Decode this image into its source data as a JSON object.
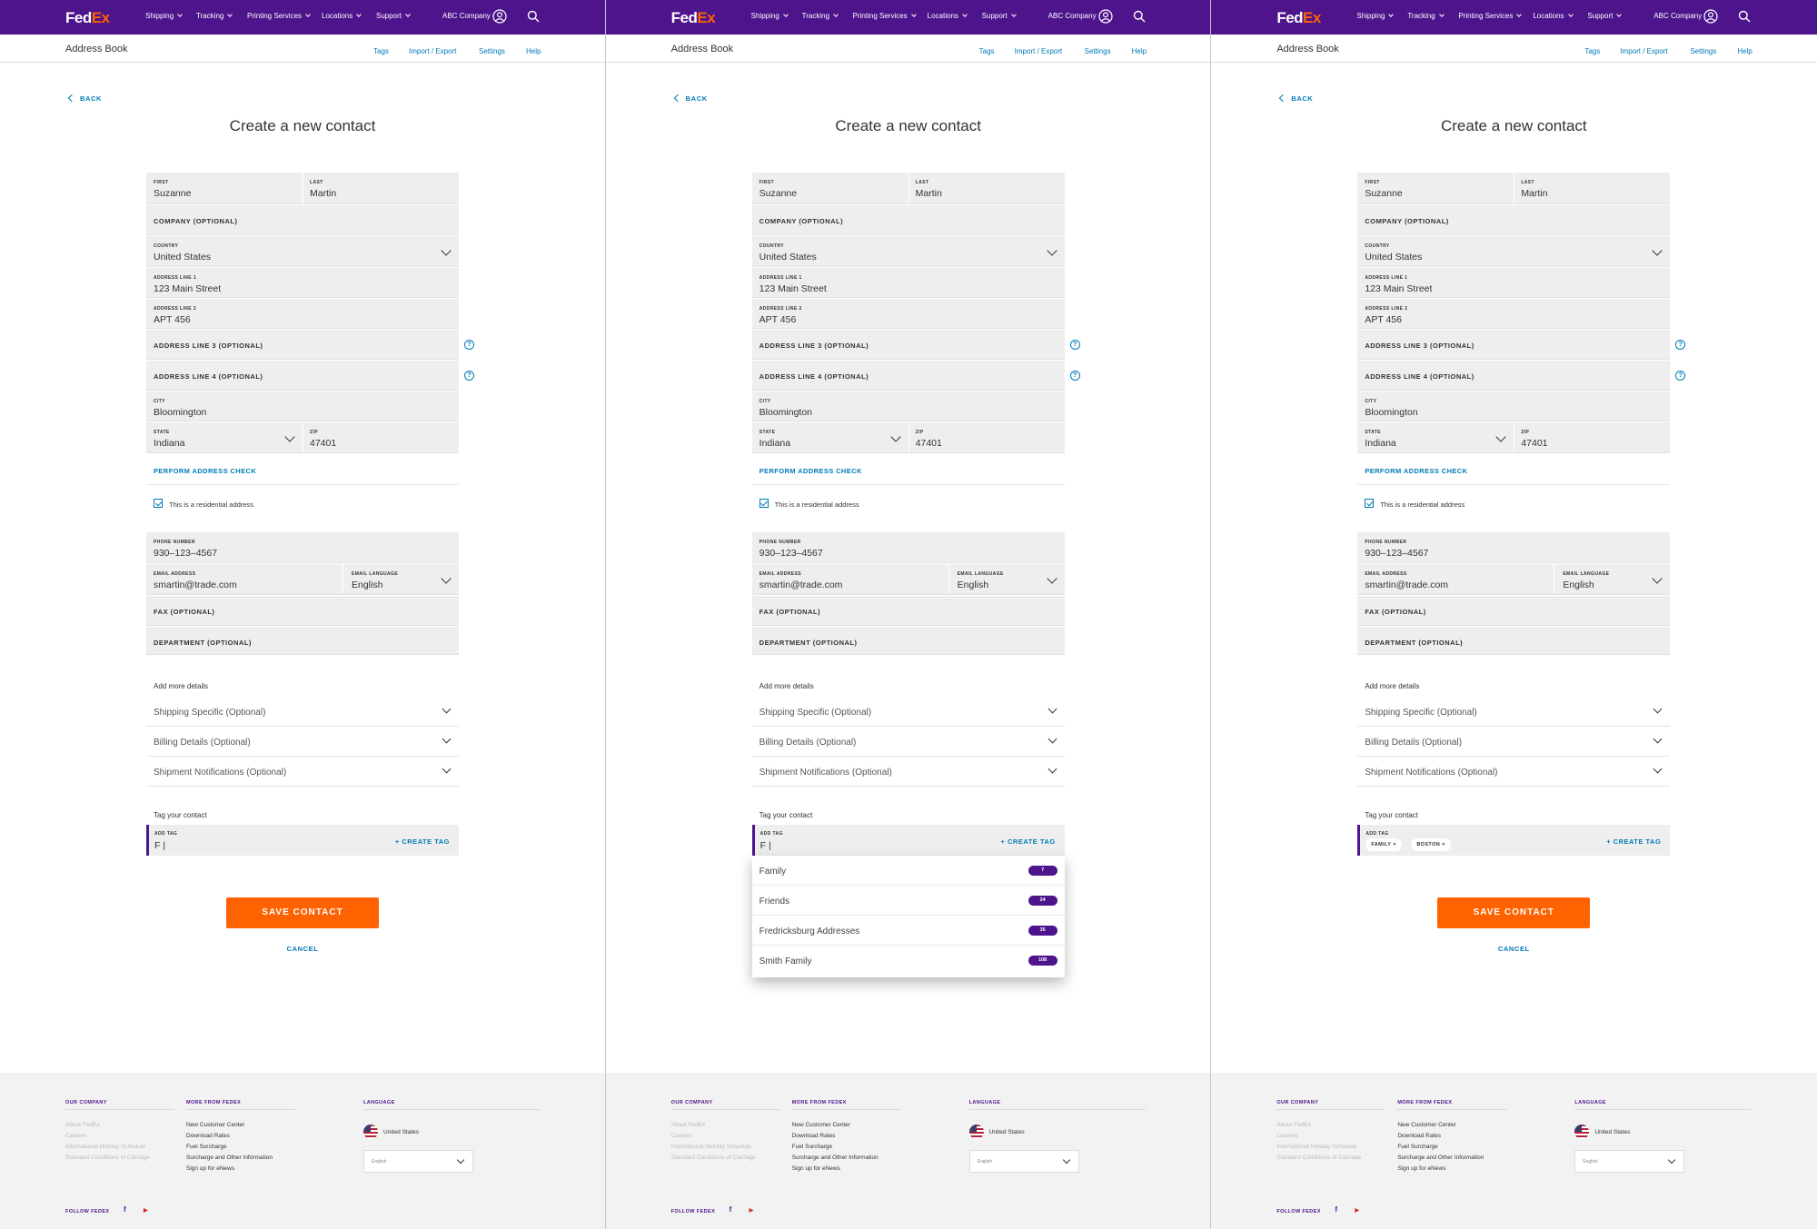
{
  "colors": {
    "brand_purple": "#4d148c",
    "brand_orange": "#ff6200",
    "link_blue": "#007ab7"
  },
  "nav": {
    "logo_fed": "Fed",
    "logo_ex": "Ex",
    "items": [
      "Shipping",
      "Tracking",
      "Printing Services",
      "Locations",
      "Support"
    ],
    "account": "ABC Company",
    "account_icon": "user-circle-icon",
    "search_icon": "search-icon"
  },
  "subnav": {
    "title": "Address Book",
    "links": [
      "Tags",
      "Import / Export",
      "Settings",
      "Help"
    ]
  },
  "back": "BACK",
  "page_title": "Create a new contact",
  "form": {
    "first_label": "FIRST",
    "first_value": "Suzanne",
    "last_label": "LAST",
    "last_value": "Martin",
    "company": "COMPANY (OPTIONAL)",
    "country_label": "COUNTRY",
    "country_value": "United States",
    "addr1_label": "ADDRESS LINE 1",
    "addr1_value": "123 Main Street",
    "addr2_label": "ADDRESS LINE 2",
    "addr2_value": "APT 456",
    "addr3": "ADDRESS LINE 3 (OPTIONAL)",
    "addr4": "ADDRESS LINE 4 (OPTIONAL)",
    "city_label": "CITY",
    "city_value": "Bloomington",
    "state_label": "STATE",
    "state_value": "Indiana",
    "zip_label": "ZIP",
    "zip_value": "47401",
    "address_check": "PERFORM ADDRESS CHECK",
    "residential": "This is a residential address",
    "phone_label": "PHONE NUMBER",
    "phone_value": "930–123–4567",
    "email_label": "EMAIL ADDRESS",
    "email_value": "smartin@trade.com",
    "email_lang_label": "EMAIL LANGUAGE",
    "email_lang_value": "English",
    "fax": "FAX (OPTIONAL)",
    "department": "DEPARTMENT (OPTIONAL)",
    "help_glyph": "?"
  },
  "more_details": {
    "title": "Add more details",
    "sections": [
      "Shipping Specific (Optional)",
      "Billing Details (Optional)",
      "Shipment Notifications (Optional)"
    ]
  },
  "tags": {
    "title": "Tag your contact",
    "add_label": "ADD TAG",
    "input_value": "F |",
    "create": "+ CREATE TAG",
    "suggestions": [
      {
        "name": "Family",
        "count": "7"
      },
      {
        "name": "Friends",
        "count": "24"
      },
      {
        "name": "Fredricksburg Addresses",
        "count": "35"
      },
      {
        "name": "Smith Family",
        "count": "108"
      }
    ],
    "chips": [
      "FAMILY ×",
      "BOSTON ×"
    ]
  },
  "save": "SAVE CONTACT",
  "cancel": "CANCEL",
  "footer": {
    "our_company": "OUR COMPANY",
    "our_company_links": [
      "About FedEx",
      "Careers",
      "International Holiday Schedule",
      "Standard Conditions of Carriage"
    ],
    "more_from_fedex": "MORE FROM FEDEX",
    "more_links": [
      "New Customer Center",
      "Download Rates",
      "Fuel Surcharge",
      "Surcharge and Other Information",
      "Sign up for eNews"
    ],
    "language": "LANGUAGE",
    "country": "United States",
    "language_select": "English",
    "follow": "FOLLOW FEDEX",
    "facebook": "f",
    "youtube": "▶"
  }
}
